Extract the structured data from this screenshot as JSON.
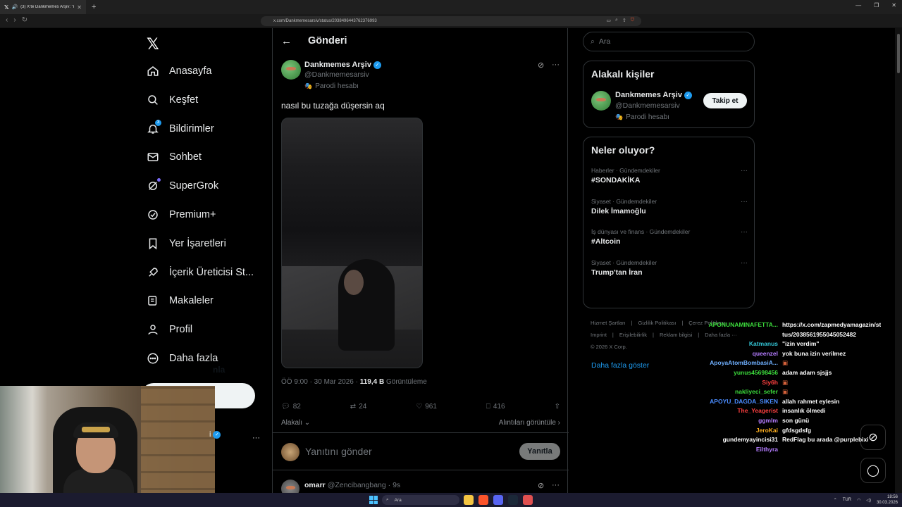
{
  "browser": {
    "tab_title": "(3) X'te Dankmemes Arşiv: \"n",
    "url": "x.com/Dankmemesarsiv/status/2038496443762376993"
  },
  "nav": {
    "items": [
      {
        "label": "Anasayfa",
        "icon": "home-icon"
      },
      {
        "label": "Keşfet",
        "icon": "search-icon"
      },
      {
        "label": "Bildirimler",
        "icon": "bell-icon",
        "badge": "3"
      },
      {
        "label": "Sohbet",
        "icon": "mail-icon"
      },
      {
        "label": "SuperGrok",
        "icon": "grok-icon"
      },
      {
        "label": "Premium+",
        "icon": "verified-badge-icon"
      },
      {
        "label": "Yer İşaretleri",
        "icon": "bookmark-icon"
      },
      {
        "label": "İçerik Üreticisi St...",
        "icon": "rocket-icon"
      },
      {
        "label": "Makaleler",
        "icon": "article-icon"
      },
      {
        "label": "Profil",
        "icon": "person-icon"
      },
      {
        "label": "Daha fazla",
        "icon": "more-circle-icon"
      }
    ],
    "post_button_visible": "nla",
    "account_fragment": "i"
  },
  "post": {
    "header_title": "Gönderi",
    "author_name": "Dankmemes Arşiv",
    "author_handle": "@Dankmemesarsiv",
    "parody_label": "Parodi hesabı",
    "text": "nasıl bu tuzağa düşersin aq",
    "timestamp": "ÖÖ 9:00 · 30 Mar 2026 · ",
    "views": "119,4 B",
    "views_label": " Görüntüleme",
    "replies": "82",
    "reposts": "24",
    "likes": "961",
    "bookmarks": "416",
    "related_label": "Alakalı",
    "quotes_label": "Alıntıları görüntüle",
    "reply_placeholder": "Yanıtını gönder",
    "reply_button": "Yanıtla",
    "next_reply_name": "omarr",
    "next_reply_handle": "@Zencibangbang",
    "next_reply_time": "· 9s"
  },
  "sidebar": {
    "search_placeholder": "Ara",
    "related_title": "Alakalı kişiler",
    "related_name": "Dankmemes Arşiv",
    "related_handle": "@Dankmemesarsiv",
    "related_parody": "Parodi hesabı",
    "follow_button": "Takip et",
    "trends_title": "Neler oluyor?",
    "trends": [
      {
        "category": "Haberler · Gündemdekiler",
        "name": "#SONDAKİKA"
      },
      {
        "category": "Siyaset · Gündemdekiler",
        "name": "Dilek İmamoğlu"
      },
      {
        "category": "İş dünyası ve finans · Gündemdekiler",
        "name": "#Altcoin"
      },
      {
        "category": "Siyaset · Gündemdekiler",
        "name": "Trump'tan İran"
      }
    ],
    "show_more": "Daha fazla göster",
    "footer": [
      "Hizmet Şartları",
      "Gizlilik Politikası",
      "Çerez Politikası",
      "Imprint",
      "Erişilebilirlik",
      "Reklam bilgisi",
      "Daha fazla ···",
      "© 2026 X Corp."
    ]
  },
  "chat": [
    {
      "user": "APONUNAMINAFETTA...",
      "msg": "https://x.com/zapmedyamagazin/sta",
      "color": "#3cdc3c"
    },
    {
      "user": "",
      "msg": "tus/2038561955045052482",
      "color": "#3cdc3c"
    },
    {
      "user": "Katmanus",
      "msg": "\"izin verdim\"",
      "color": "#33c5d6"
    },
    {
      "user": "queenzel",
      "msg": "yok buna izin verilmez",
      "color": "#b47cff"
    },
    {
      "user": "ApoyaAtomBombasiA...",
      "msg": "▣",
      "color": "#6fb0ff"
    },
    {
      "user": "yunus45698456",
      "msg": "adam adam sjsjjs",
      "color": "#3cdc3c"
    },
    {
      "user": "Siy6h",
      "msg": "▣",
      "color": "#ff4040"
    },
    {
      "user": "nakliyeci_sefer",
      "msg": "▣",
      "color": "#3cdc3c"
    },
    {
      "user": "APOYU_DAGDA_SIKEN",
      "msg": "allah rahmet eylesin",
      "color": "#4a8cff"
    },
    {
      "user": "The_Yeagerist",
      "msg": "insanlık ölmedi",
      "color": "#ff4040"
    },
    {
      "user": "ggmlm",
      "msg": "son günü",
      "color": "#b47cff"
    },
    {
      "user": "JeroKai",
      "msg": "gfdsgdsfg",
      "color": "#ffb020"
    },
    {
      "user": "gundemyayincisi31",
      "msg": "RedFlag bu arada @purplebixi",
      "color": "#ffffff"
    },
    {
      "user": "Eilthyra",
      "msg": "",
      "color": "#b47cff"
    }
  ],
  "taskbar": {
    "search": "Ara",
    "lang": "TUR",
    "time": "18:56",
    "date": "30.03.2026"
  }
}
